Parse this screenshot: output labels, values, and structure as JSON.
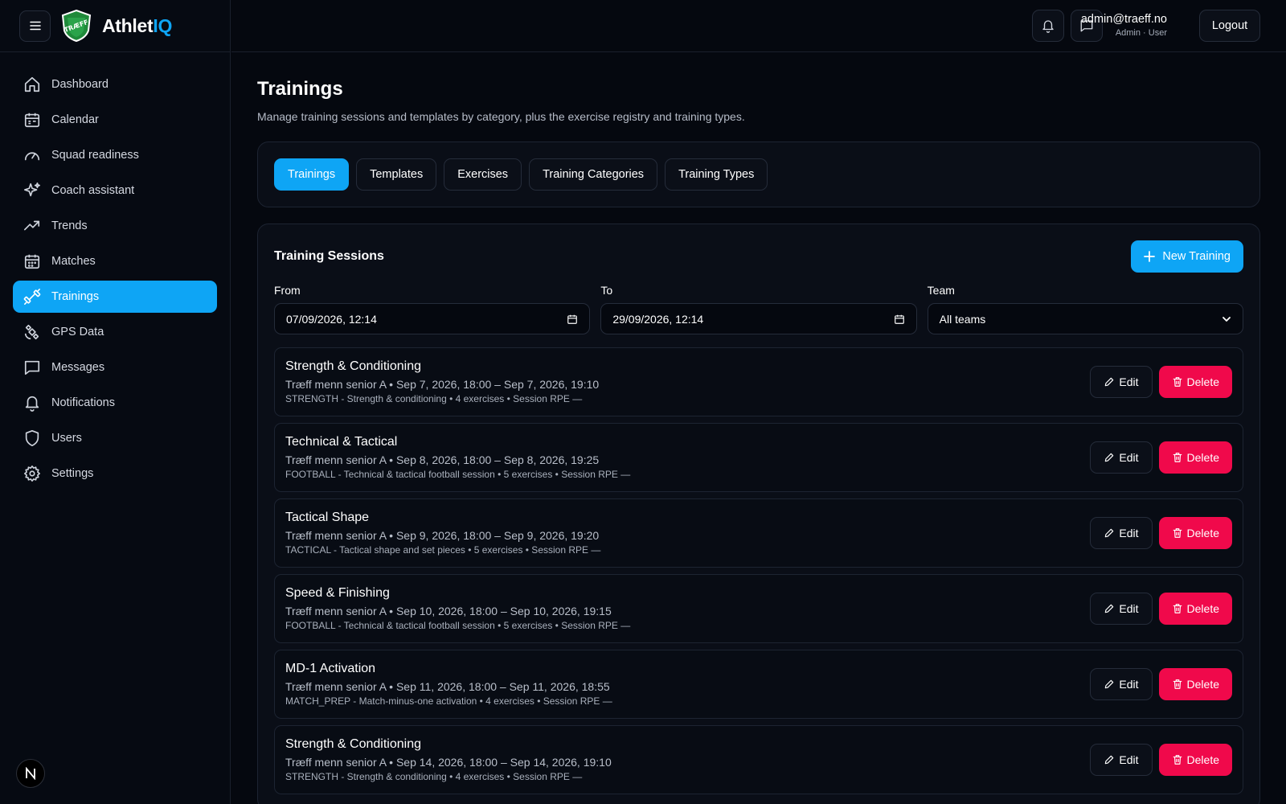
{
  "app": {
    "brand_main": "Athlet",
    "brand_accent": "IQ",
    "logo_text": "TRÆFF"
  },
  "sidebar": {
    "items": [
      {
        "label": "Dashboard",
        "icon": "home-icon"
      },
      {
        "label": "Calendar",
        "icon": "calendar-icon"
      },
      {
        "label": "Squad readiness",
        "icon": "gauge-icon"
      },
      {
        "label": "Coach assistant",
        "icon": "sparkles-icon"
      },
      {
        "label": "Trends",
        "icon": "trending-up-icon"
      },
      {
        "label": "Matches",
        "icon": "calendar-grid-icon"
      },
      {
        "label": "Trainings",
        "icon": "dumbbell-icon",
        "active": true
      },
      {
        "label": "GPS Data",
        "icon": "satellite-icon"
      },
      {
        "label": "Messages",
        "icon": "message-icon"
      },
      {
        "label": "Notifications",
        "icon": "bell-icon"
      },
      {
        "label": "Users",
        "icon": "shield-icon"
      },
      {
        "label": "Settings",
        "icon": "gear-icon"
      }
    ],
    "badge": "N"
  },
  "topbar": {
    "email": "admin@traeff.no",
    "role": "Admin · User",
    "logout": "Logout"
  },
  "page": {
    "title": "Trainings",
    "subtitle": "Manage training sessions and templates by category, plus the exercise registry and training types."
  },
  "tabs": [
    {
      "label": "Trainings",
      "active": true
    },
    {
      "label": "Templates"
    },
    {
      "label": "Exercises"
    },
    {
      "label": "Training Categories"
    },
    {
      "label": "Training Types"
    }
  ],
  "sessions": {
    "title": "Training Sessions",
    "new_button": "New Training",
    "filters": {
      "from_label": "From",
      "from_value": "07/09/2026, 12:14",
      "to_label": "To",
      "to_value": "29/09/2026, 12:14",
      "team_label": "Team",
      "team_value": "All teams"
    },
    "edit_label": "Edit",
    "delete_label": "Delete",
    "rows": [
      {
        "title": "Strength & Conditioning",
        "meta": "Træff menn senior A • Sep 7, 2026, 18:00 – Sep 7, 2026, 19:10",
        "sub": "STRENGTH - Strength & conditioning • 4 exercises • Session RPE —"
      },
      {
        "title": "Technical & Tactical",
        "meta": "Træff menn senior A • Sep 8, 2026, 18:00 – Sep 8, 2026, 19:25",
        "sub": "FOOTBALL - Technical & tactical football session • 5 exercises • Session RPE —"
      },
      {
        "title": "Tactical Shape",
        "meta": "Træff menn senior A • Sep 9, 2026, 18:00 – Sep 9, 2026, 19:20",
        "sub": "TACTICAL - Tactical shape and set pieces • 5 exercises • Session RPE —"
      },
      {
        "title": "Speed & Finishing",
        "meta": "Træff menn senior A • Sep 10, 2026, 18:00 – Sep 10, 2026, 19:15",
        "sub": "FOOTBALL - Technical & tactical football session • 5 exercises • Session RPE —"
      },
      {
        "title": "MD-1 Activation",
        "meta": "Træff menn senior A • Sep 11, 2026, 18:00 – Sep 11, 2026, 18:55",
        "sub": "MATCH_PREP - Match-minus-one activation • 4 exercises • Session RPE —"
      },
      {
        "title": "Strength & Conditioning",
        "meta": "Træff menn senior A • Sep 14, 2026, 18:00 – Sep 14, 2026, 19:10",
        "sub": "STRENGTH - Strength & conditioning • 4 exercises • Session RPE —"
      }
    ]
  },
  "colors": {
    "accent": "#0ea5f5",
    "danger": "#f0094b",
    "background": "#05080f"
  }
}
